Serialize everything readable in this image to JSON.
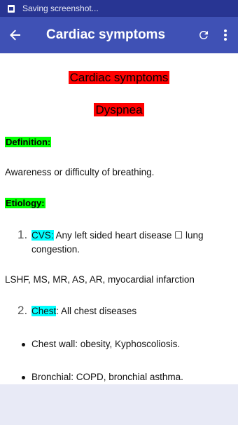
{
  "status_bar": {
    "text": "Saving screenshot...",
    "icon": "screenshot-icon"
  },
  "app_bar": {
    "title": "Cardiac symptoms",
    "back_icon": "arrow-back-icon",
    "refresh_icon": "refresh-icon",
    "more_icon": "more-vert-icon",
    "color": "#3f51b5"
  },
  "content": {
    "heading": "Cardiac symptoms",
    "subheading": "Dyspnea",
    "definition_label": "Definition:",
    "definition_text": "Awareness or difficulty of breathing.",
    "etiology_label": " Etiology:",
    "item1": {
      "number": "1.",
      "keyword": "CVS:",
      "text_line1": " Any left sided heart disease ☐ lung",
      "text_line2": "congestion."
    },
    "causes": "LSHF, MS, MR, AS, AR, myocardial infarction",
    "item2": {
      "number": "2.",
      "keyword": "Chest",
      "text": ": All chest diseases"
    },
    "bullets": [
      "Chest wall: obesity, Kyphoscoliosis.",
      "Bronchial: COPD, bronchial asthma."
    ]
  },
  "colors": {
    "highlight_red": "#ff0000",
    "highlight_green": "#00ff00",
    "highlight_cyan": "#00ffff"
  }
}
